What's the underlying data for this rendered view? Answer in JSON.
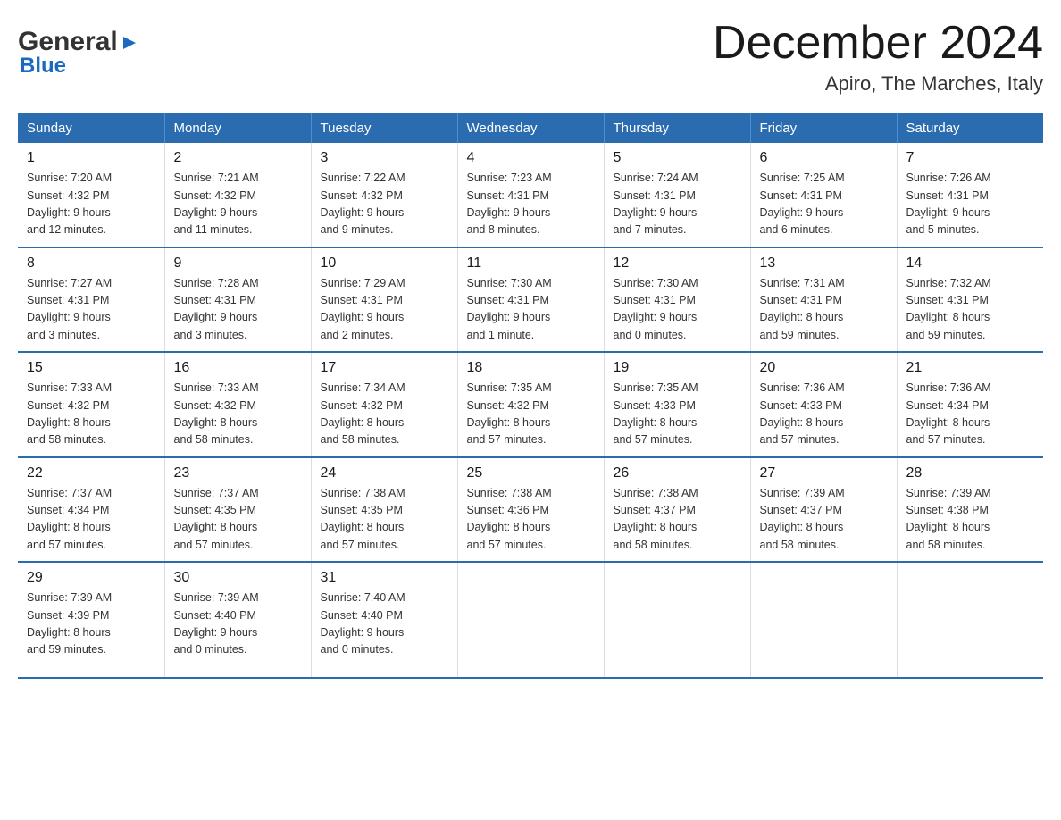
{
  "logo": {
    "text_general": "General",
    "text_blue": "Blue",
    "arrow_symbol": "▶"
  },
  "title": "December 2024",
  "location": "Apiro, The Marches, Italy",
  "days_of_week": [
    "Sunday",
    "Monday",
    "Tuesday",
    "Wednesday",
    "Thursday",
    "Friday",
    "Saturday"
  ],
  "weeks": [
    [
      {
        "day": "1",
        "sunrise": "Sunrise: 7:20 AM",
        "sunset": "Sunset: 4:32 PM",
        "daylight": "Daylight: 9 hours",
        "daylight2": "and 12 minutes."
      },
      {
        "day": "2",
        "sunrise": "Sunrise: 7:21 AM",
        "sunset": "Sunset: 4:32 PM",
        "daylight": "Daylight: 9 hours",
        "daylight2": "and 11 minutes."
      },
      {
        "day": "3",
        "sunrise": "Sunrise: 7:22 AM",
        "sunset": "Sunset: 4:32 PM",
        "daylight": "Daylight: 9 hours",
        "daylight2": "and 9 minutes."
      },
      {
        "day": "4",
        "sunrise": "Sunrise: 7:23 AM",
        "sunset": "Sunset: 4:31 PM",
        "daylight": "Daylight: 9 hours",
        "daylight2": "and 8 minutes."
      },
      {
        "day": "5",
        "sunrise": "Sunrise: 7:24 AM",
        "sunset": "Sunset: 4:31 PM",
        "daylight": "Daylight: 9 hours",
        "daylight2": "and 7 minutes."
      },
      {
        "day": "6",
        "sunrise": "Sunrise: 7:25 AM",
        "sunset": "Sunset: 4:31 PM",
        "daylight": "Daylight: 9 hours",
        "daylight2": "and 6 minutes."
      },
      {
        "day": "7",
        "sunrise": "Sunrise: 7:26 AM",
        "sunset": "Sunset: 4:31 PM",
        "daylight": "Daylight: 9 hours",
        "daylight2": "and 5 minutes."
      }
    ],
    [
      {
        "day": "8",
        "sunrise": "Sunrise: 7:27 AM",
        "sunset": "Sunset: 4:31 PM",
        "daylight": "Daylight: 9 hours",
        "daylight2": "and 3 minutes."
      },
      {
        "day": "9",
        "sunrise": "Sunrise: 7:28 AM",
        "sunset": "Sunset: 4:31 PM",
        "daylight": "Daylight: 9 hours",
        "daylight2": "and 3 minutes."
      },
      {
        "day": "10",
        "sunrise": "Sunrise: 7:29 AM",
        "sunset": "Sunset: 4:31 PM",
        "daylight": "Daylight: 9 hours",
        "daylight2": "and 2 minutes."
      },
      {
        "day": "11",
        "sunrise": "Sunrise: 7:30 AM",
        "sunset": "Sunset: 4:31 PM",
        "daylight": "Daylight: 9 hours",
        "daylight2": "and 1 minute."
      },
      {
        "day": "12",
        "sunrise": "Sunrise: 7:30 AM",
        "sunset": "Sunset: 4:31 PM",
        "daylight": "Daylight: 9 hours",
        "daylight2": "and 0 minutes."
      },
      {
        "day": "13",
        "sunrise": "Sunrise: 7:31 AM",
        "sunset": "Sunset: 4:31 PM",
        "daylight": "Daylight: 8 hours",
        "daylight2": "and 59 minutes."
      },
      {
        "day": "14",
        "sunrise": "Sunrise: 7:32 AM",
        "sunset": "Sunset: 4:31 PM",
        "daylight": "Daylight: 8 hours",
        "daylight2": "and 59 minutes."
      }
    ],
    [
      {
        "day": "15",
        "sunrise": "Sunrise: 7:33 AM",
        "sunset": "Sunset: 4:32 PM",
        "daylight": "Daylight: 8 hours",
        "daylight2": "and 58 minutes."
      },
      {
        "day": "16",
        "sunrise": "Sunrise: 7:33 AM",
        "sunset": "Sunset: 4:32 PM",
        "daylight": "Daylight: 8 hours",
        "daylight2": "and 58 minutes."
      },
      {
        "day": "17",
        "sunrise": "Sunrise: 7:34 AM",
        "sunset": "Sunset: 4:32 PM",
        "daylight": "Daylight: 8 hours",
        "daylight2": "and 58 minutes."
      },
      {
        "day": "18",
        "sunrise": "Sunrise: 7:35 AM",
        "sunset": "Sunset: 4:32 PM",
        "daylight": "Daylight: 8 hours",
        "daylight2": "and 57 minutes."
      },
      {
        "day": "19",
        "sunrise": "Sunrise: 7:35 AM",
        "sunset": "Sunset: 4:33 PM",
        "daylight": "Daylight: 8 hours",
        "daylight2": "and 57 minutes."
      },
      {
        "day": "20",
        "sunrise": "Sunrise: 7:36 AM",
        "sunset": "Sunset: 4:33 PM",
        "daylight": "Daylight: 8 hours",
        "daylight2": "and 57 minutes."
      },
      {
        "day": "21",
        "sunrise": "Sunrise: 7:36 AM",
        "sunset": "Sunset: 4:34 PM",
        "daylight": "Daylight: 8 hours",
        "daylight2": "and 57 minutes."
      }
    ],
    [
      {
        "day": "22",
        "sunrise": "Sunrise: 7:37 AM",
        "sunset": "Sunset: 4:34 PM",
        "daylight": "Daylight: 8 hours",
        "daylight2": "and 57 minutes."
      },
      {
        "day": "23",
        "sunrise": "Sunrise: 7:37 AM",
        "sunset": "Sunset: 4:35 PM",
        "daylight": "Daylight: 8 hours",
        "daylight2": "and 57 minutes."
      },
      {
        "day": "24",
        "sunrise": "Sunrise: 7:38 AM",
        "sunset": "Sunset: 4:35 PM",
        "daylight": "Daylight: 8 hours",
        "daylight2": "and 57 minutes."
      },
      {
        "day": "25",
        "sunrise": "Sunrise: 7:38 AM",
        "sunset": "Sunset: 4:36 PM",
        "daylight": "Daylight: 8 hours",
        "daylight2": "and 57 minutes."
      },
      {
        "day": "26",
        "sunrise": "Sunrise: 7:38 AM",
        "sunset": "Sunset: 4:37 PM",
        "daylight": "Daylight: 8 hours",
        "daylight2": "and 58 minutes."
      },
      {
        "day": "27",
        "sunrise": "Sunrise: 7:39 AM",
        "sunset": "Sunset: 4:37 PM",
        "daylight": "Daylight: 8 hours",
        "daylight2": "and 58 minutes."
      },
      {
        "day": "28",
        "sunrise": "Sunrise: 7:39 AM",
        "sunset": "Sunset: 4:38 PM",
        "daylight": "Daylight: 8 hours",
        "daylight2": "and 58 minutes."
      }
    ],
    [
      {
        "day": "29",
        "sunrise": "Sunrise: 7:39 AM",
        "sunset": "Sunset: 4:39 PM",
        "daylight": "Daylight: 8 hours",
        "daylight2": "and 59 minutes."
      },
      {
        "day": "30",
        "sunrise": "Sunrise: 7:39 AM",
        "sunset": "Sunset: 4:40 PM",
        "daylight": "Daylight: 9 hours",
        "daylight2": "and 0 minutes."
      },
      {
        "day": "31",
        "sunrise": "Sunrise: 7:40 AM",
        "sunset": "Sunset: 4:40 PM",
        "daylight": "Daylight: 9 hours",
        "daylight2": "and 0 minutes."
      },
      {
        "day": "",
        "sunrise": "",
        "sunset": "",
        "daylight": "",
        "daylight2": ""
      },
      {
        "day": "",
        "sunrise": "",
        "sunset": "",
        "daylight": "",
        "daylight2": ""
      },
      {
        "day": "",
        "sunrise": "",
        "sunset": "",
        "daylight": "",
        "daylight2": ""
      },
      {
        "day": "",
        "sunrise": "",
        "sunset": "",
        "daylight": "",
        "daylight2": ""
      }
    ]
  ]
}
